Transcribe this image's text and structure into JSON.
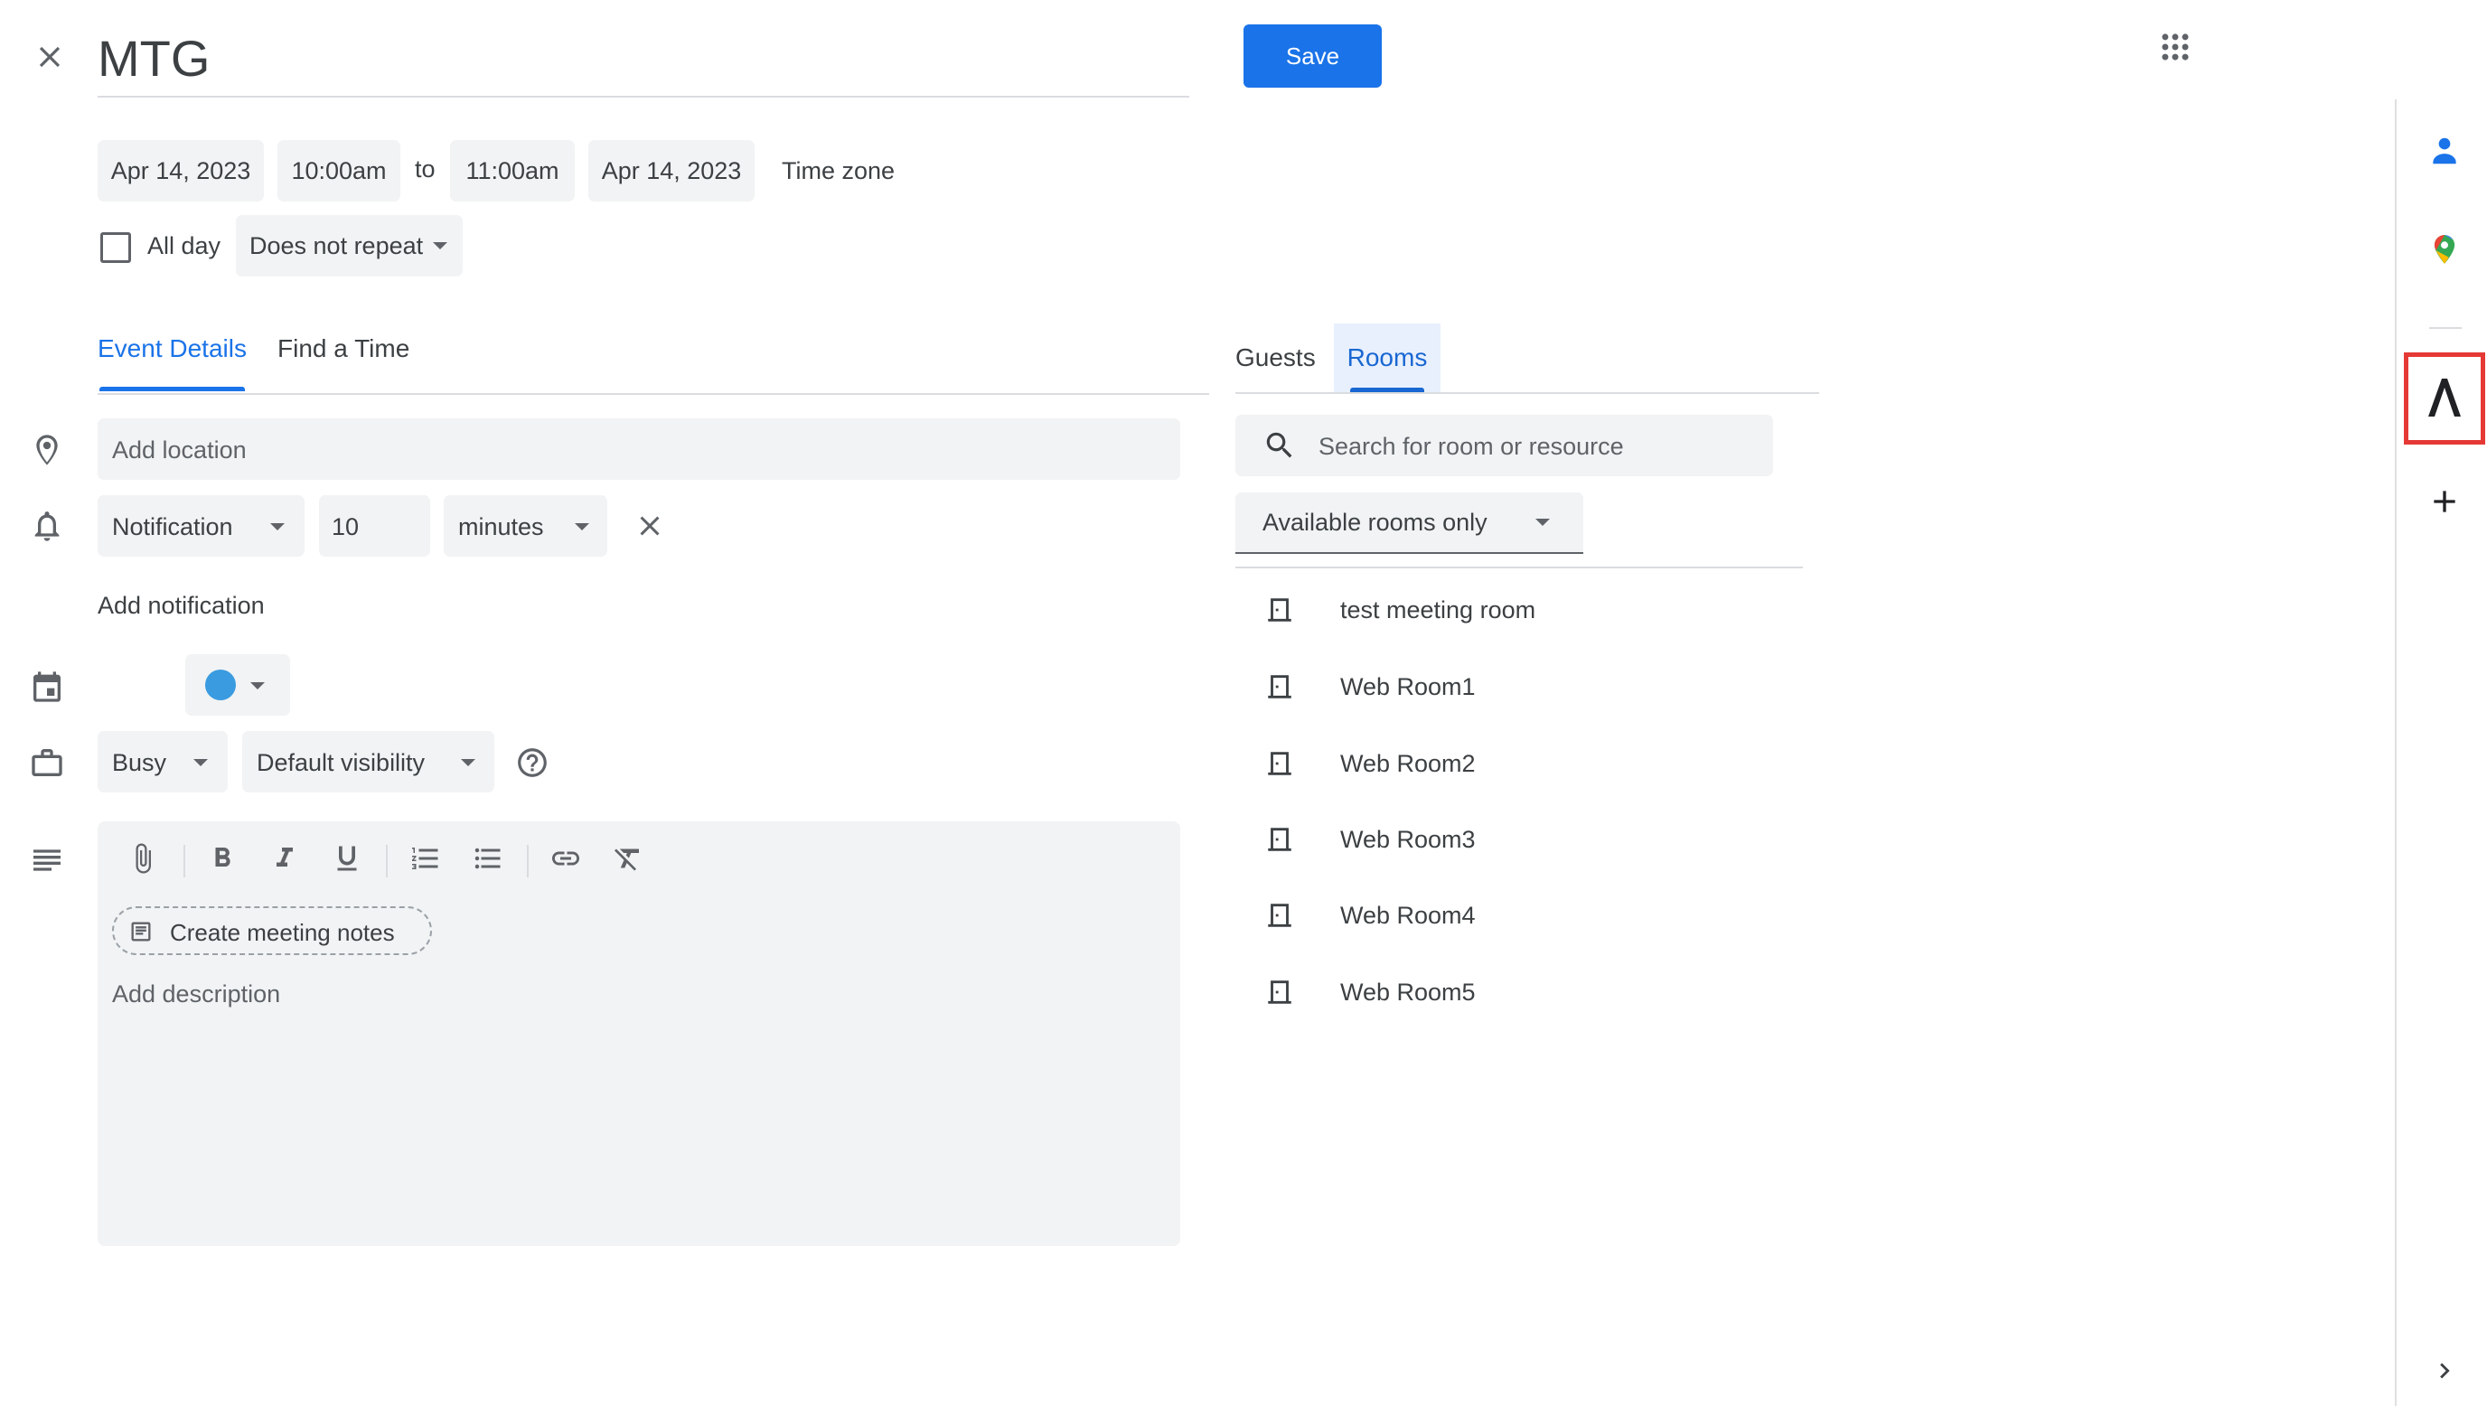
{
  "header": {
    "title": "MTG",
    "save_label": "Save"
  },
  "datetime": {
    "start_date": "Apr 14, 2023",
    "start_time": "10:00am",
    "to_label": "to",
    "end_time": "11:00am",
    "end_date": "Apr 14, 2023",
    "timezone_label": "Time zone",
    "all_day_label": "All day",
    "repeat_value": "Does not repeat"
  },
  "left_tabs": [
    {
      "label": "Event Details",
      "active": true
    },
    {
      "label": "Find a Time",
      "active": false
    }
  ],
  "details": {
    "location_placeholder": "Add location",
    "notification_type": "Notification",
    "notification_value": "10",
    "notification_unit": "minutes",
    "add_notification_label": "Add notification",
    "color": "#3a9be0",
    "busy_value": "Busy",
    "visibility_value": "Default visibility",
    "create_notes_label": "Create meeting notes",
    "description_placeholder": "Add description"
  },
  "right_tabs": [
    {
      "label": "Guests",
      "active": false
    },
    {
      "label": "Rooms",
      "active": true
    }
  ],
  "rooms": {
    "search_placeholder": "Search for room or resource",
    "filter_value": "Available rooms only",
    "items": [
      "test meeting room",
      "Web Room1",
      "Web Room2",
      "Web Room3",
      "Web Room4",
      "Web Room5"
    ]
  },
  "colors": {
    "accent": "#1a73e8",
    "highlight_box": "#e53935",
    "tab_active_bg": "#e8f0fe"
  },
  "side_panel": {
    "icons": [
      "contacts-icon",
      "maps-icon",
      "addon-lambda-icon",
      "add-icon",
      "chevron-right-icon"
    ]
  }
}
